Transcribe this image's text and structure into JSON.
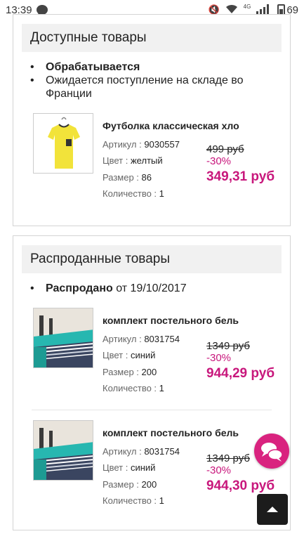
{
  "status": {
    "time": "13:39",
    "battery": "69",
    "net": "4G"
  },
  "available": {
    "title": "Доступные товары",
    "bullets": [
      {
        "bold": "Обрабатывается",
        "rest": ""
      },
      {
        "bold": "",
        "rest": "Ожидается поступление на складе во Франции"
      }
    ],
    "items": [
      {
        "name": "Футболка классическая хло",
        "sku_label": "Артикул :",
        "sku": "9030557",
        "color_label": "Цвет :",
        "color": "желтый",
        "size_label": "Размер :",
        "size": "86",
        "qty_label": "Количество :",
        "qty": "1",
        "old_price": "499 руб",
        "discount": "-30%",
        "new_price": "349,31 руб"
      }
    ]
  },
  "sold": {
    "title": "Распроданные товары",
    "bullets": [
      {
        "bold": "Распродано",
        "rest": " от 19/10/2017"
      }
    ],
    "items": [
      {
        "name": "комплект постельного бель",
        "sku_label": "Артикул :",
        "sku": "8031754",
        "color_label": "Цвет :",
        "color": "синий",
        "size_label": "Размер :",
        "size": "200",
        "qty_label": "Количество :",
        "qty": "1",
        "old_price": "1349 руб",
        "discount": "-30%",
        "new_price": "944,29 руб"
      },
      {
        "name": "комплект постельного бель",
        "sku_label": "Артикул :",
        "sku": "8031754",
        "color_label": "Цвет :",
        "color": "синий",
        "size_label": "Размер :",
        "size": "200",
        "qty_label": "Количество :",
        "qty": "1",
        "old_price": "1349 руб",
        "discount": "-30%",
        "new_price": "944,30 руб"
      }
    ]
  },
  "colors": {
    "accent": "#c8177c"
  }
}
